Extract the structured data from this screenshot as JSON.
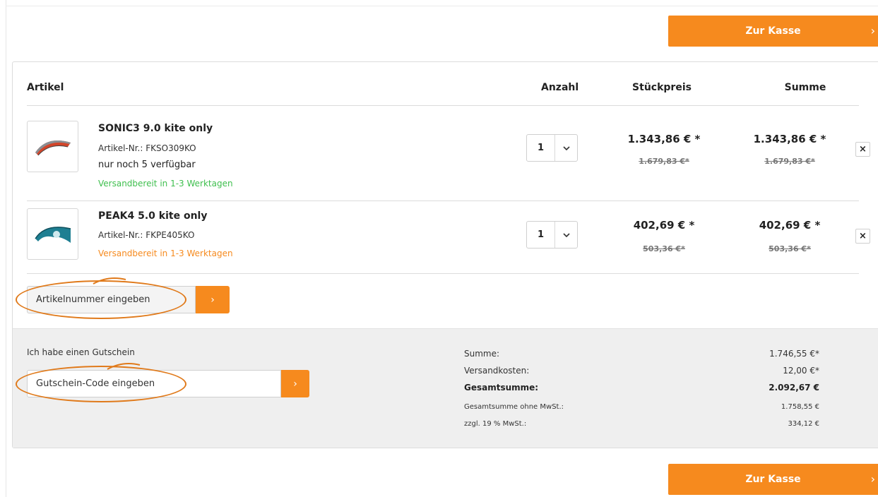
{
  "checkout": {
    "label": "Zur Kasse",
    "chevron": "›"
  },
  "table": {
    "headers": {
      "artikel": "Artikel",
      "anzahl": "Anzahl",
      "stueckpreis": "Stückpreis",
      "summe": "Summe"
    }
  },
  "items": [
    {
      "title": "SONIC3 9.0 kite only",
      "sku": "Artikel-Nr.: FKSO309KO",
      "stock": "nur noch 5 verfügbar",
      "shipping": "Versandbereit in 1-3 Werktagen",
      "shipping_color": "#3fbf4e",
      "qty": "1",
      "unit_price": "1.343,86 € *",
      "unit_price_old": "1.679,83 €*",
      "total": "1.343,86 € *",
      "total_old": "1.679,83 €*",
      "thumb_icon": "kite-red-icon"
    },
    {
      "title": "PEAK4 5.0 kite only",
      "sku": "Artikel-Nr.: FKPE405KO",
      "shipping": "Versandbereit in 1-3 Werktagen",
      "shipping_color": "#f68a1e",
      "qty": "1",
      "unit_price": "402,69 € *",
      "unit_price_old": "503,36 €*",
      "total": "402,69 € *",
      "total_old": "503,36 €*",
      "thumb_icon": "kite-teal-icon"
    }
  ],
  "controls": {
    "remove": "×",
    "qty_chevron": "⌄",
    "go_chevron": "›"
  },
  "article_entry": {
    "placeholder": "Artikelnummer eingeben"
  },
  "voucher": {
    "label": "Ich habe einen Gutschein",
    "placeholder": "Gutschein-Code eingeben"
  },
  "summary": [
    {
      "label": "Summe:",
      "value": "1.746,55 €*"
    },
    {
      "label": "Versandkosten:",
      "value": "12,00 €*"
    },
    {
      "label": "Gesamtsumme:",
      "value": "2.092,67 €"
    },
    {
      "label": "Gesamtsumme ohne MwSt.:",
      "value": "1.758,55 €"
    },
    {
      "label": "zzgl. 19 % MwSt.:",
      "value": "334,12 €"
    }
  ],
  "colors": {
    "accent": "#f68a1e",
    "annotation": "#e07a1b",
    "ship_green": "#3fbf4e"
  }
}
